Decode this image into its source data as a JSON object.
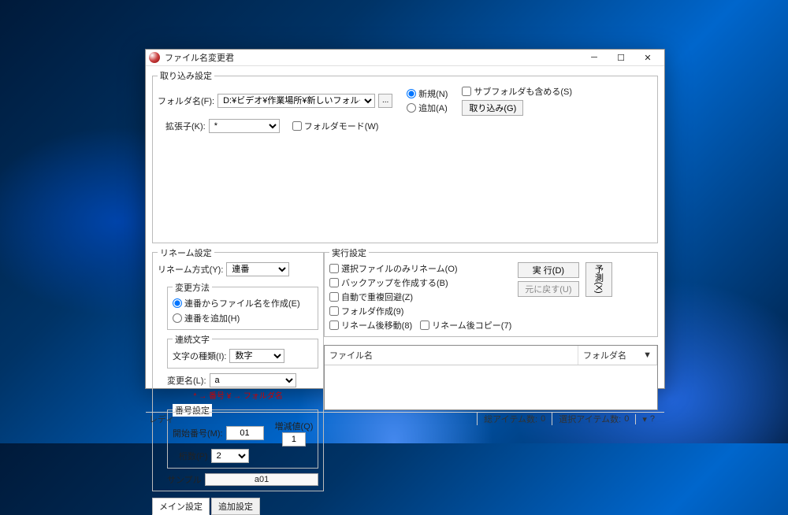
{
  "window": {
    "title": "ファイル名変更君"
  },
  "import": {
    "legend": "取り込み設定",
    "folder_label": "フォルダ名(F):",
    "folder_value": "D:¥ビデオ¥作業場所¥新しいフォルダー",
    "browse_btn": "...",
    "ext_label": "拡張子(K):",
    "ext_value": "*",
    "foldermode": "フォルダモード(W)",
    "radio_new": "新規(N)",
    "radio_add": "追加(A)",
    "subfolder": "サブフォルダも含める(S)",
    "import_btn": "取り込み(G)"
  },
  "rename": {
    "legend": "リネーム設定",
    "method_label": "リネーム方式(Y):",
    "method_value": "連番",
    "change_method_legend": "変更方法",
    "radio_from_seq": "連番からファイル名を作成(E)",
    "radio_add_seq": "連番を追加(H)",
    "seq_char_legend": "連続文字",
    "char_type_label": "文字の種類(I):",
    "char_type_value": "数字",
    "changename_label": "変更名(L):",
    "changename_value": "a",
    "hint": "* → 番号   ¥ → フォルダ名",
    "numset_legend": "番号設定",
    "start_label": "開始番号(M):",
    "start_value": "01",
    "inc_label": "増減値(Q)",
    "inc_value": "1",
    "digits_label": "桁数(P)",
    "digits_value": "2",
    "sample_label": "サンプル",
    "sample_value": "a01",
    "tab_main": "メイン設定",
    "tab_extra": "追加設定"
  },
  "exec": {
    "legend": "実行設定",
    "chk_selected": "選択ファイルのみリネーム(O)",
    "chk_backup": "バックアップを作成する(B)",
    "chk_auto": "自動で重複回避(Z)",
    "chk_mkfolder": "フォルダ作成(9)",
    "chk_move": "リネーム後移動(8)",
    "chk_copy": "リネーム後コピー(7)",
    "btn_run": "実 行(D)",
    "btn_undo": "元に戻す(U)",
    "btn_preview": "予測(X)"
  },
  "table": {
    "col_filename": "ファイル名",
    "col_folder": "フォルダ名",
    "triangle": "▼"
  },
  "status": {
    "ready": "レディ",
    "total_label": "総アイテム数:",
    "total_value": "0",
    "sel_label": "選択アイテム数:",
    "sel_value": "0",
    "help": "?"
  }
}
